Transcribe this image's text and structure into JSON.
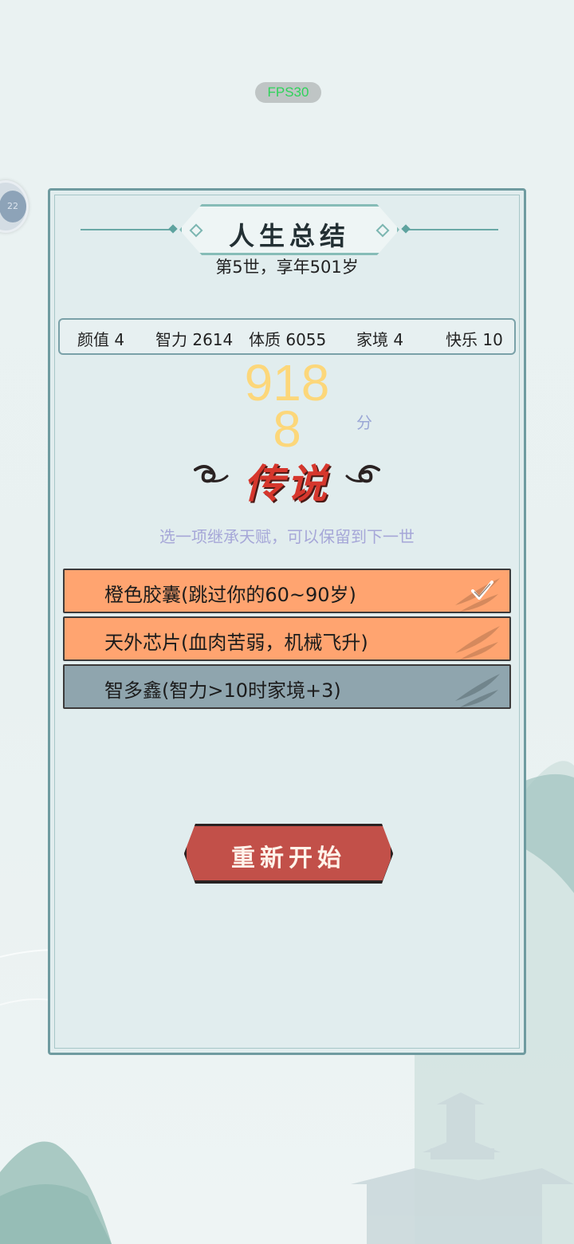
{
  "overlay": {
    "fps_label": "FPS30",
    "float_ball_label": "22"
  },
  "summary": {
    "title": "人生总结",
    "subtitle": "第5世，享年501岁",
    "stats": [
      {
        "label": "颜值 4"
      },
      {
        "label": "智力 2614"
      },
      {
        "label": "体质 6055"
      },
      {
        "label": "家境 4"
      },
      {
        "label": "快乐 10"
      }
    ],
    "score": "9188",
    "score_unit": "分",
    "grade": "传说",
    "inherit_hint": "选一项继承天赋，可以保留到下一世",
    "talents": [
      {
        "label": "橙色胶囊(跳过你的60~90岁)",
        "color": "#ffa470",
        "selected": true
      },
      {
        "label": "天外芯片(血肉苦弱，机械飞升)",
        "color": "#ffa470",
        "selected": false
      },
      {
        "label": "智多鑫(智力>10时家境+3)",
        "color": "#8fa5ae",
        "selected": false
      }
    ],
    "restart_label": "重新开始"
  },
  "colors": {
    "panel_bg": "#e1edee",
    "panel_border": "#6f9ba0",
    "score": "#fcd77a",
    "grade": "#d6372d",
    "restart_bg": "#c25049"
  },
  "icons": [
    "checkmark-icon",
    "bamboo-leaf-icon",
    "cloud-swirl-icon",
    "diamond-ornament-icon"
  ]
}
